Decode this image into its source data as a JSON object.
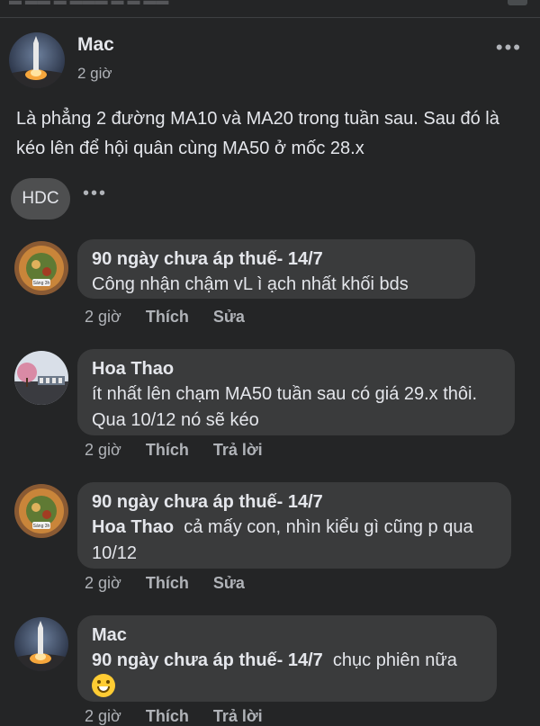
{
  "post": {
    "author": "Mac",
    "time": "2 giờ",
    "text": "Là phẳng 2 đường MA10 và MA20 trong tuần sau. Sau đó là kéo lên để hội quân cùng MA50 ở mốc 28.x",
    "tag": "HDC"
  },
  "comments": [
    {
      "author": "90 ngày chưa áp thuế- 14/7",
      "text": "Công nhận chậm vL ì ạch nhất khối bds",
      "time": "2 giờ",
      "like": "Thích",
      "action": "Sửa",
      "avatar_label": "Sáng 3h"
    },
    {
      "author": "Hoa Thao",
      "text": "ít nhất lên chạm MA50 tuần sau có giá 29.x thôi. Qua 10/12 nó sẽ kéo",
      "time": "2 giờ",
      "like": "Thích",
      "action": "Trả lời"
    },
    {
      "author": "90 ngày chưa áp thuế- 14/7",
      "mention": "Hoa Thao",
      "text": "cả mấy con, nhìn kiểu gì cũng p qua 10/12",
      "time": "2 giờ",
      "like": "Thích",
      "action": "Sửa",
      "avatar_label": "Sáng 3h"
    },
    {
      "author": "Mac",
      "mention": "90 ngày chưa áp thuế- 14/7",
      "text": "chục phiên nữa",
      "time": "2 giờ",
      "like": "Thích",
      "action": "Trả lời"
    }
  ],
  "colors": {
    "background": "#242526",
    "bubble": "#3a3b3c",
    "text": "#e4e6eb",
    "secondary": "#b0b3b8"
  },
  "icons": {
    "post_menu": "more-horizontal-icon",
    "tag_menu": "more-horizontal-icon",
    "emoji": "grinning-face-icon"
  }
}
